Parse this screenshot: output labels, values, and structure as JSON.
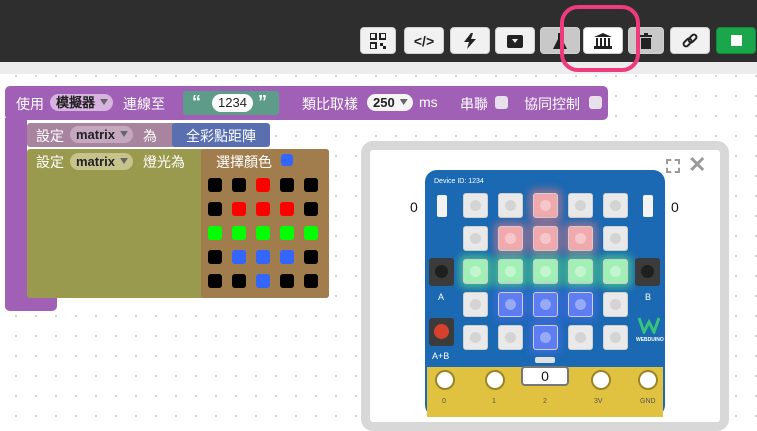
{
  "toolbar": {
    "buttons": [
      {
        "icon": "qr-code-icon"
      },
      {
        "icon": "code-icon"
      },
      {
        "icon": "lightning-icon"
      },
      {
        "icon": "download-box-icon"
      },
      {
        "icon": "flask-icon"
      },
      {
        "icon": "museum-icon"
      },
      {
        "icon": "trash-icon"
      },
      {
        "icon": "link-icon"
      },
      {
        "icon": "stop-icon"
      }
    ],
    "highlight_color": "#ef3a7e"
  },
  "block_use": {
    "label_use": "使用",
    "device_dropdown": "模擬器",
    "label_connect_to": "連線至",
    "quote_open": "“",
    "device_id": "1234",
    "quote_close": "”",
    "label_sample": "類比取樣",
    "sample_dropdown": "250",
    "label_ms": "ms",
    "label_serial": "串聯",
    "label_coop": "協同控制"
  },
  "block_set1": {
    "label_set": "設定",
    "var_dropdown": "matrix",
    "label_as": "為",
    "value": "全彩點距陣"
  },
  "block_set2": {
    "label_set": "設定",
    "var_dropdown": "matrix",
    "label_light": "燈光為",
    "label_choose": "選擇顏色"
  },
  "block_grid": [
    [
      "#000000",
      "#000000",
      "#ff0000",
      "#000000",
      "#000000"
    ],
    [
      "#000000",
      "#ff0000",
      "#ff0000",
      "#ff0000",
      "#000000"
    ],
    [
      "#00ff00",
      "#00ff00",
      "#00ff00",
      "#00ff00",
      "#00ff00"
    ],
    [
      "#000000",
      "#3366ff",
      "#3366ff",
      "#3366ff",
      "#000000"
    ],
    [
      "#000000",
      "#000000",
      "#3366ff",
      "#000000",
      "#000000"
    ]
  ],
  "simulator": {
    "device_id_label": "Device ID: 1234",
    "left_value": "0",
    "right_value": "0",
    "button_a": "A",
    "button_b": "B",
    "button_ab": "A+B",
    "pin_value": "0",
    "pins": [
      "0",
      "1",
      "2",
      "3V",
      "GND"
    ],
    "brand": "WEBDUINO",
    "led_grid": [
      [
        "off",
        "off",
        "red",
        "off",
        "off"
      ],
      [
        "off",
        "red",
        "red",
        "red",
        "off"
      ],
      [
        "green",
        "green",
        "green",
        "green",
        "green"
      ],
      [
        "off",
        "blue",
        "blue",
        "blue",
        "off"
      ],
      [
        "off",
        "off",
        "blue",
        "off",
        "off"
      ]
    ]
  }
}
